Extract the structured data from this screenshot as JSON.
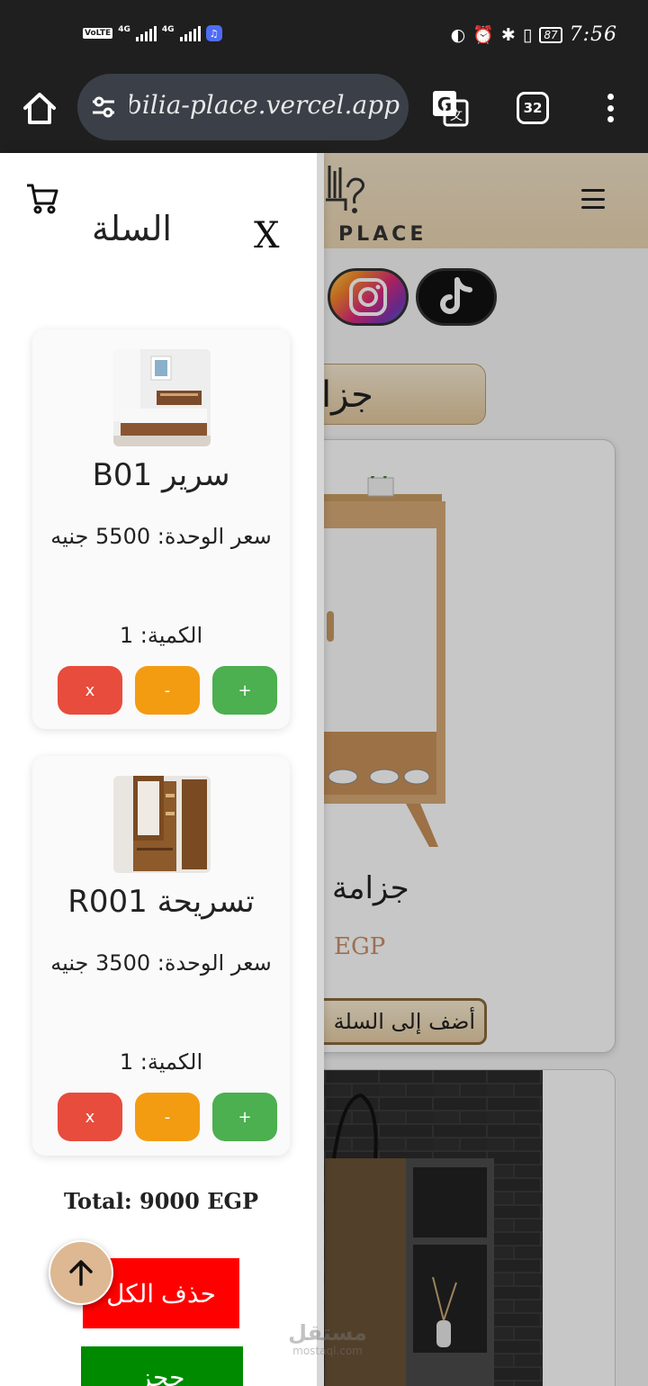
{
  "status_bar": {
    "left_tags": [
      "VoLTE",
      "4G",
      "4G"
    ],
    "battery": "87",
    "time": "7:56"
  },
  "browser": {
    "url": "mobilia-place.vercel.app",
    "tab_count": "32"
  },
  "site": {
    "logo_text": "PLACE",
    "category_title": "جزا",
    "product_1": {
      "name": "جزامة",
      "price": "EGP",
      "add_to_cart": "أضف إلى السلة"
    }
  },
  "cart": {
    "title": "السلة",
    "close_label": "X",
    "items": [
      {
        "name": "سرير B01",
        "unit_price": "سعر الوحدة: 5500 جنيه",
        "quantity": "الكمية: 1",
        "remove_label": "x",
        "minus_label": "-",
        "plus_label": "+"
      },
      {
        "name": "تسريحة R001",
        "unit_price": "سعر الوحدة: 3500 جنيه",
        "quantity": "الكمية: 1",
        "remove_label": "x",
        "minus_label": "-",
        "plus_label": "+"
      }
    ],
    "total": "Total: 9000 EGP",
    "clear_all_label": "حذف الكل",
    "checkout_label": "حجز"
  },
  "watermark": {
    "arabic": "مستقل",
    "latin": "mostaql.com"
  },
  "colors": {
    "remove": "#e74c3c",
    "minus": "#f39c12",
    "plus": "#4caf50",
    "clear_all": "#ff0000",
    "checkout": "#008a00",
    "brand_beige": "#e9d4b0"
  }
}
